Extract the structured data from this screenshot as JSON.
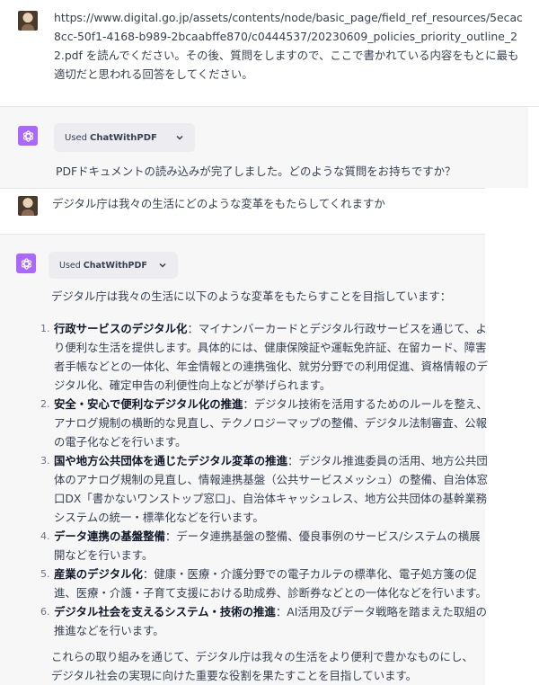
{
  "conversation": {
    "user_message_1": "https://www.digital.go.jp/assets/contents/node/basic_page/field_ref_resources/5ecac8cc-50f1-4168-b989-2bcaabffe870/c0444537/20230609_policies_priority_outline_22.pdf を読んでください。その後、質問をしますので、ここで書かれている内容をもとに最も適切だと思われる回答をしてください。",
    "assistant_1": {
      "plugin_prefix": "Used",
      "plugin_name": "ChatWithPDF",
      "message": "PDFドキュメントの読み込みが完了しました。どのような質問をお持ちですか？"
    },
    "user_message_2": "デジタル庁は我々の生活にどのような変革をもたらしてくれますか",
    "assistant_2": {
      "plugin_prefix": "Used",
      "plugin_name": "ChatWithPDF",
      "intro": "デジタル庁は我々の生活に以下のような変革をもたらすことを目指しています：",
      "items": [
        {
          "num": "1.",
          "title": "行政サービスのデジタル化",
          "text": "：マイナンバーカードとデジタル行政サービスを通じて、より便利な生活を提供します。具体的には、健康保険証や運転免許証、在留カード、障害者手帳などとの一体化、年金情報との連携強化、就労分野での利用促進、資格情報のデジタル化、確定申告の利便性向上などが挙げられます。"
        },
        {
          "num": "2.",
          "title": "安全・安心で便利なデジタル化の推進",
          "text": "：デジタル技術を活用するためのルールを整え、アナログ規制の横断的な見直し、テクノロジーマップの整備、デジタル法制審査、公報の電子化などを行います。"
        },
        {
          "num": "3.",
          "title": "国や地方公共団体を通じたデジタル変革の推進",
          "text": "：デジタル推進委員の活用、地方公共団体のアナログ規制の見直し、情報連携基盤（公共サービスメッシュ）の整備、自治体窓口DX「書かないワンストップ窓口」、自治体キャッシュレス、地方公共団体の基幹業務システムの統一・標準化などを行います。"
        },
        {
          "num": "4.",
          "title": "データ連携の基盤整備",
          "text": "：データ連携基盤の整備、優良事例のサービス/システムの横展開などを行います。"
        },
        {
          "num": "5.",
          "title": "産業のデジタル化",
          "text": "：健康・医療・介護分野での電子カルテの標準化、電子処方箋の促進、医療・介護・子育て支援における助成券、診断券などとの一体化などを行います。"
        },
        {
          "num": "6.",
          "title": "デジタル社会を支えるシステム・技術の推進",
          "text": "：AI活用及びデータ戦略を踏まえた取組の推進などを行います。"
        }
      ],
      "conclusion": "これらの取り組みを通じて、デジタル庁は我々の生活をより便利で豊かなものにし、デジタル社会の実現に向けた重要な役割を果たすことを目指しています。"
    }
  },
  "colors": {
    "bot_avatar": "#ab68ff",
    "band_gray": "#f7f7f8",
    "text": "#374151"
  },
  "icons": {
    "bot_avatar": "openai-logo-icon",
    "plugin_chevron": "chevron-down-icon"
  }
}
